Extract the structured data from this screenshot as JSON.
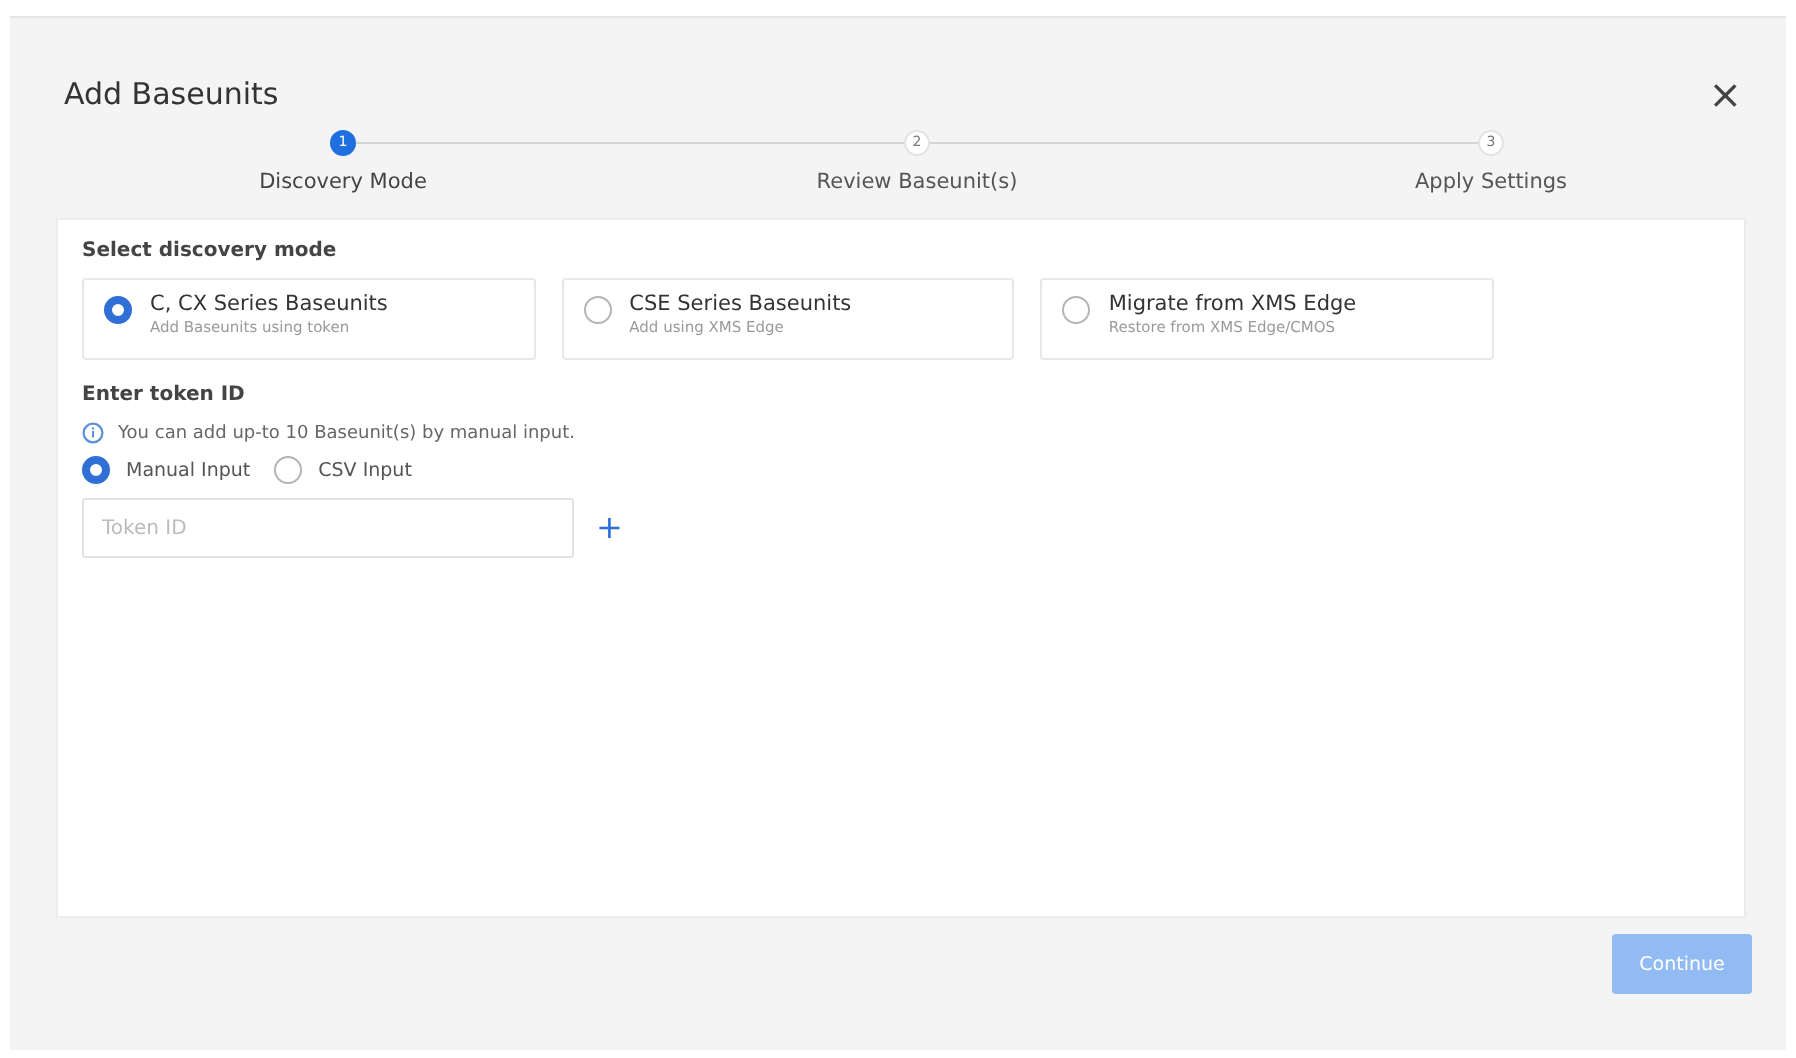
{
  "dialog": {
    "title": "Add Baseunits",
    "close": "×"
  },
  "steps": [
    {
      "number": "1",
      "label": "Discovery Mode",
      "selected": true
    },
    {
      "number": "2",
      "label": "Review Baseunit(s)",
      "selected": false
    },
    {
      "number": "3",
      "label": "Apply Settings",
      "selected": false
    }
  ],
  "discovery": {
    "heading": "Select discovery mode",
    "modes": [
      {
        "title": "C, CX Series Baseunits",
        "subtitle": "Add Baseunits using token",
        "selected": true
      },
      {
        "title": "CSE Series Baseunits",
        "subtitle": "Add using XMS Edge",
        "selected": false
      },
      {
        "title": "Migrate from XMS Edge",
        "subtitle": "Restore from XMS Edge/CMOS",
        "selected": false
      }
    ]
  },
  "token": {
    "heading": "Enter token ID",
    "info": "You can add up-to 10 Baseunit(s) by manual input.",
    "inputs": [
      {
        "label": "Manual Input",
        "selected": true
      },
      {
        "label": "CSV Input",
        "selected": false
      }
    ],
    "placeholder": "Token ID",
    "add": "+"
  },
  "footer": {
    "button": "Continue",
    "disabled": true
  }
}
